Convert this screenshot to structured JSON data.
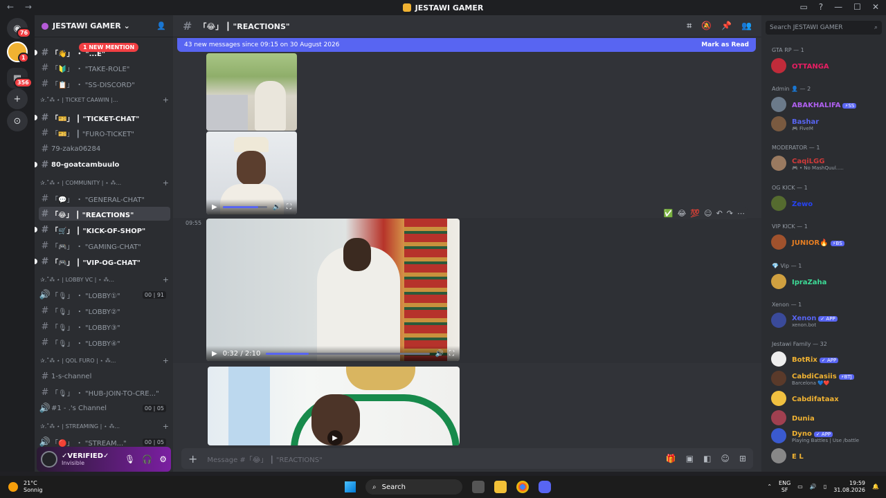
{
  "window": {
    "title": "JESTAWI GAMER",
    "nav": "← →"
  },
  "guilds": {
    "home_badge": "76",
    "server_badge": "1",
    "folder_badge": "356"
  },
  "server": {
    "name": "JESTAWI GAMER"
  },
  "sidebar": {
    "mention": "1 NEW MENTION",
    "channels": [
      {
        "label": "「👋」 ・ \"...E\"",
        "bold": true
      },
      {
        "label": "「🔰」 ・ \"TAKE-ROLE\""
      },
      {
        "label": "「📋」 ・ \"SS-DISCORD\""
      },
      {
        "category": "✰.˚⁂ ⋆ | TICKET CAAWIN |..."
      },
      {
        "label": "「🎫」 ┃ \"TICKET-CHAT\"",
        "bold": true
      },
      {
        "label": "「🎫」 ┃ \"FURO-TICKET\""
      },
      {
        "label": "79-zaka06284"
      },
      {
        "label": "80-goatcambuulo",
        "bold": true
      },
      {
        "category": "✰.˚⁂ ⋆ | COMMUNITY | ⋆ ⁂..."
      },
      {
        "label": "「💬」 ・ \"GENERAL-CHAT\""
      },
      {
        "label": "「😂」 ┃ \"REACTIONS\"",
        "selected": true
      },
      {
        "label": "「🛒」 ┃ \"KICK-OF-SHOP\"",
        "bold": true
      },
      {
        "label": "「🎮」 ・ \"GAMING-CHAT\""
      },
      {
        "label": "「🎮」 ┃ \"VIP-OG-CHAT\"",
        "bold": true
      },
      {
        "category": "✰.˚⁂ ⋆ | LOBBY VC | ⋆ ⁂..."
      },
      {
        "label": "「🎙」 ・ \"LOBBY①\"",
        "count": "00 | 91"
      },
      {
        "label": "「🎙」 ・ \"LOBBY②\""
      },
      {
        "label": "「🎙」 ・ \"LOBBY③\""
      },
      {
        "label": "「🎙」 ・ \"LOBBY④\""
      },
      {
        "category": "✰.˚⁂ ⋆ | QOL FURO | ⋆ ⁂..."
      },
      {
        "label": "1-s-channel"
      },
      {
        "label": "「🎙」 ・ \"HUB-JOIN-TO-CRE...\""
      },
      {
        "label": "#1 - .'s Channel",
        "count": "00 | 05"
      },
      {
        "category": "✰.˚⁂ ⋆ | STREAMING | ⋆ ⁂..."
      },
      {
        "label": "「🔴」 ・ \"STREAM...\"",
        "count": "00 | 05"
      }
    ]
  },
  "user": {
    "name": "✓VERIFIED✓",
    "status": "Invisible"
  },
  "chat": {
    "channel": "「😂」 ┃ \"REACTIONS\"",
    "new_messages": "43 new messages since 09:15 on 30 August 2026",
    "mark_read": "Mark as Read",
    "timestamp": "09:55",
    "video_time": "0:32 / 2:10",
    "video_progress": 0.26,
    "composer_placeholder": "Message #「😂」 ┃ \"REACTIONS\""
  },
  "members": {
    "search": "Search JESTAWI GAMER",
    "groups": [
      {
        "title": "GTA RP — 1",
        "members": [
          {
            "name": "OTTANGA",
            "color": "#e91e63"
          }
        ]
      },
      {
        "title": "Admin 👤 — 2",
        "members": [
          {
            "name": "ABAKHALIFA",
            "color": "#b060f0",
            "tag": "⚡SS"
          },
          {
            "name": "Bashar",
            "sub": "🎮 FiveM",
            "color": "#5865f2"
          }
        ]
      },
      {
        "title": "MODERATOR — 1",
        "members": [
          {
            "name": "CaqiLGG",
            "sub": "🎮 • No MashQuul.....",
            "color": "#d13a3a"
          }
        ]
      },
      {
        "title": "OG KICK — 1",
        "members": [
          {
            "name": "Zewo",
            "color": "#2643f2"
          }
        ]
      },
      {
        "title": "VIP KICK — 1",
        "members": [
          {
            "name": "JUNIOR🔥",
            "color": "#e67e22",
            "tag": "⚡BS"
          }
        ]
      },
      {
        "title": "💎 Vip — 1",
        "members": [
          {
            "name": "IpraZaha",
            "color": "#3ddc97"
          }
        ]
      },
      {
        "title": "Xenon — 1",
        "members": [
          {
            "name": "Xenon",
            "sub": "xenon.bot",
            "color": "#5865f2",
            "tag": "✓ APP"
          }
        ]
      },
      {
        "title": "Jestawi Family — 32",
        "members": [
          {
            "name": "BotRix",
            "color": "#f0b232",
            "tag": "✓ APP"
          },
          {
            "name": "CabdiCasiis",
            "sub": "Barcelona 💙❤️",
            "color": "#f0b232",
            "tag": "⚡BTJ"
          },
          {
            "name": "Cabdifataax",
            "color": "#f0b232"
          },
          {
            "name": "Dunia",
            "color": "#f0b232"
          },
          {
            "name": "Dyno",
            "sub": "Playing Battles | Use /battle",
            "color": "#f0b232",
            "tag": "✓ APP"
          },
          {
            "name": "E L",
            "color": "#f0b232"
          }
        ]
      }
    ]
  },
  "taskbar": {
    "temp": "21°C",
    "weather": "Sonnig",
    "search": "Search",
    "lang1": "ENG",
    "lang2": "SF",
    "time": "19:59",
    "date": "31.08.2026"
  }
}
